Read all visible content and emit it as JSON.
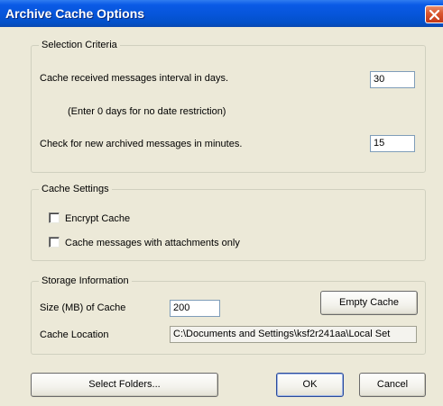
{
  "window": {
    "title": "Archive Cache Options"
  },
  "selection_criteria": {
    "legend": "Selection Criteria",
    "interval_label": "Cache received messages interval in days.",
    "interval_value": "30",
    "interval_hint": "(Enter 0 days for no date restriction)",
    "check_label": "Check for new archived messages in minutes.",
    "check_value": "15"
  },
  "cache_settings": {
    "legend": "Cache Settings",
    "encrypt_label": "Encrypt Cache",
    "encrypt_checked": false,
    "attachments_label": "Cache messages with attachments only",
    "attachments_checked": false
  },
  "storage": {
    "legend": "Storage Information",
    "size_label": "Size (MB) of Cache",
    "size_value": "200",
    "empty_button": "Empty Cache",
    "location_label": "Cache Location",
    "location_value": "C:\\Documents and Settings\\ksf2r241aa\\Local Set"
  },
  "buttons": {
    "select_folders": "Select Folders...",
    "ok": "OK",
    "cancel": "Cancel"
  },
  "icons": {
    "close": "close-icon"
  }
}
